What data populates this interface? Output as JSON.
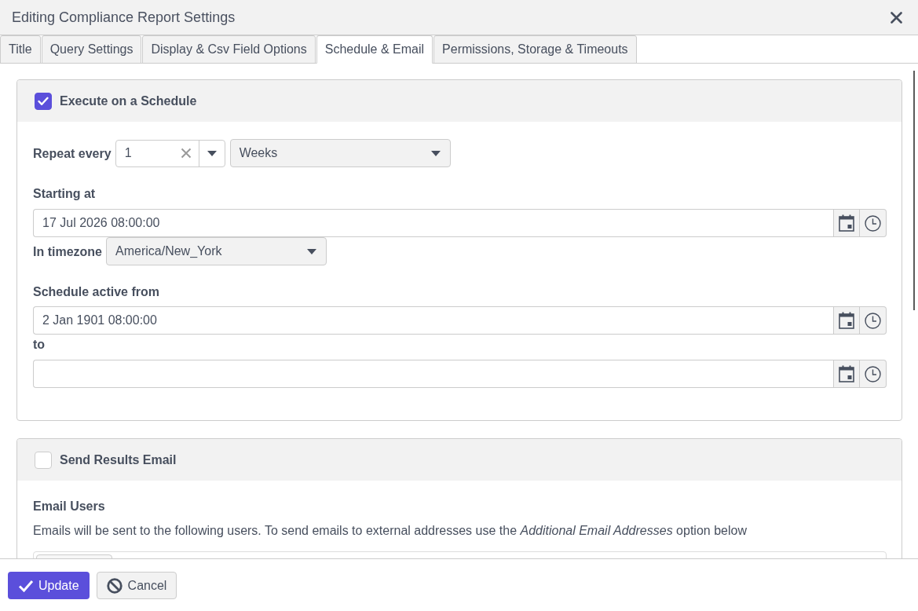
{
  "window": {
    "title": "Editing Compliance Report Settings"
  },
  "tabs": [
    {
      "label": "Title",
      "selected": false
    },
    {
      "label": "Query Settings",
      "selected": false
    },
    {
      "label": "Display & Csv Field Options",
      "selected": false
    },
    {
      "label": "Schedule & Email",
      "selected": true
    },
    {
      "label": "Permissions, Storage & Timeouts",
      "selected": false
    }
  ],
  "schedule": {
    "enabled": true,
    "label": "Execute on a Schedule",
    "repeat": {
      "label": "Repeat every",
      "value": "1",
      "unit": "Weeks"
    },
    "starting": {
      "label": "Starting at",
      "value": "17 Jul 2026 08:00:00"
    },
    "timezone": {
      "label": "In timezone",
      "value": "America/New_York"
    },
    "active_from": {
      "label": "Schedule active from",
      "value": "2 Jan 1901 08:00:00"
    },
    "active_to": {
      "label": "to"
    }
  },
  "email": {
    "enabled": false,
    "label": "Send Results Email",
    "users_heading": "Email Users",
    "users_description": "Emails will be sent to the following users. To send emails to external addresses use the *Additional Email Addresses* option below"
  },
  "buttons": [
    {
      "label": "Update",
      "kind": "primary"
    },
    {
      "label": "Cancel",
      "kind": "secondary"
    }
  ]
}
